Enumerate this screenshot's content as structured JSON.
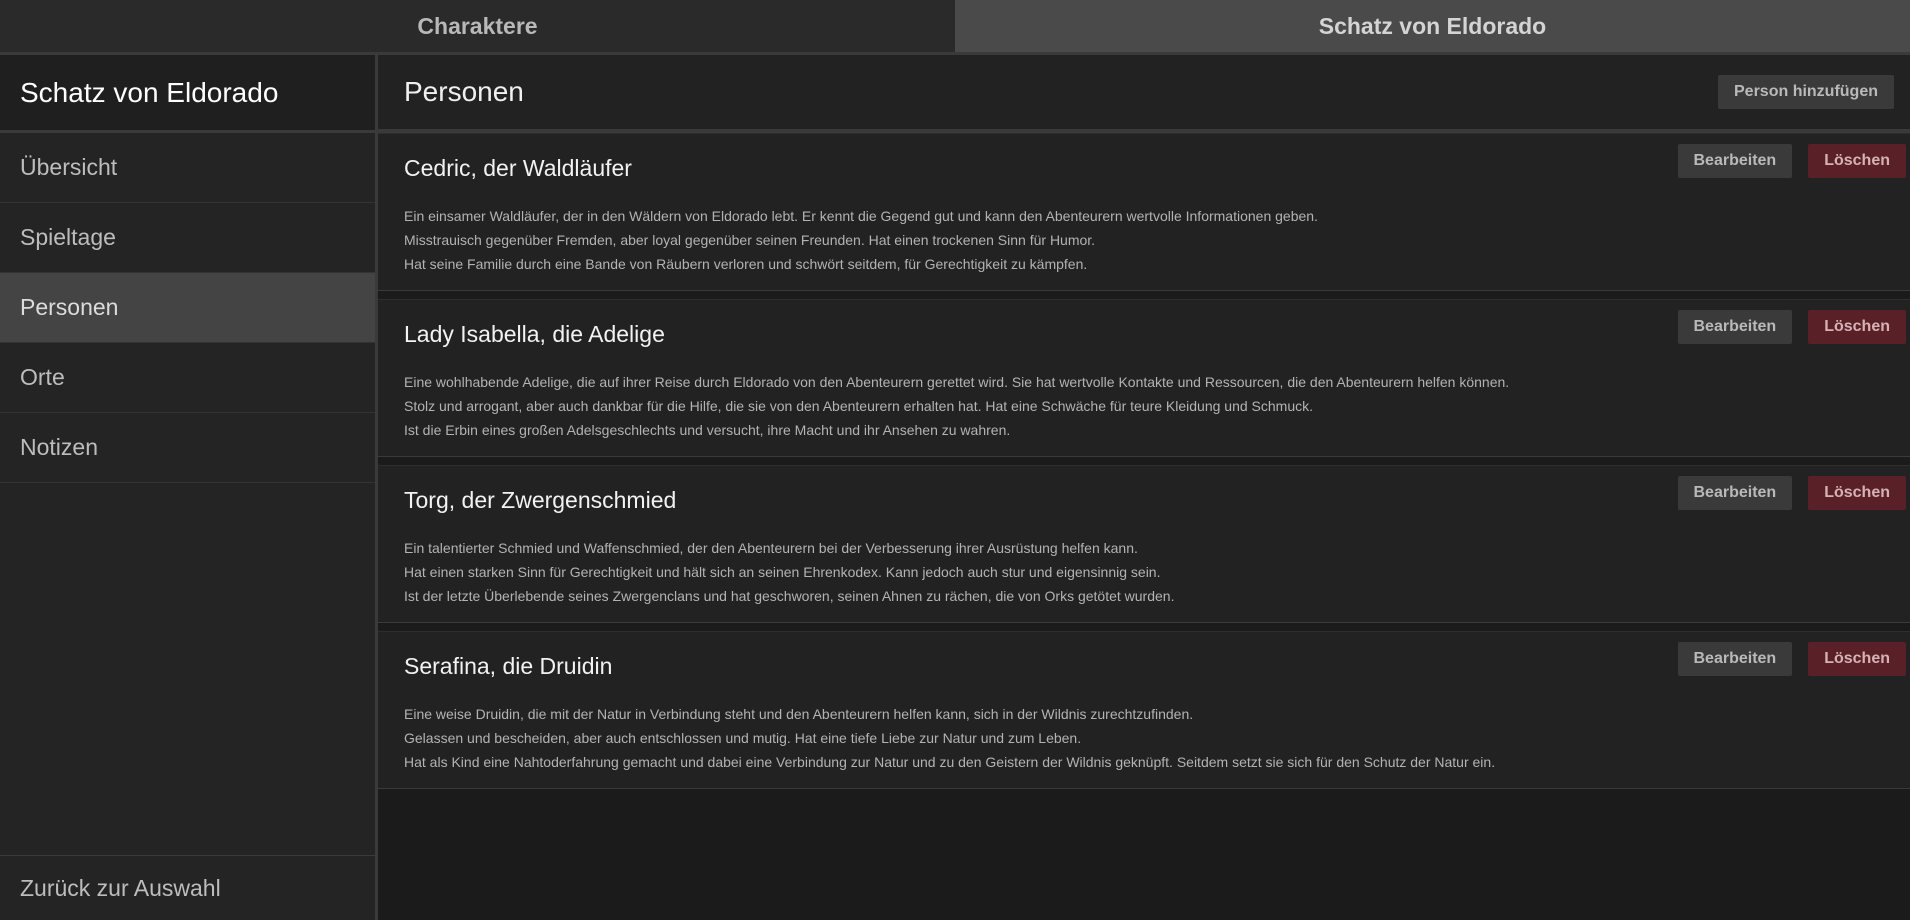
{
  "tabs": [
    {
      "label": "Charaktere",
      "active": false
    },
    {
      "label": "Schatz von Eldorado",
      "active": true
    }
  ],
  "sidebar": {
    "title": "Schatz von Eldorado",
    "items": [
      {
        "label": "Übersicht",
        "active": false
      },
      {
        "label": "Spieltage",
        "active": false
      },
      {
        "label": "Personen",
        "active": true
      },
      {
        "label": "Orte",
        "active": false
      },
      {
        "label": "Notizen",
        "active": false
      }
    ],
    "footer": "Zurück zur Auswahl"
  },
  "main": {
    "title": "Personen",
    "add_label": "Person hinzufügen",
    "edit_label": "Bearbeiten",
    "delete_label": "Löschen",
    "persons": [
      {
        "name": "Cedric, der Waldläufer",
        "lines": [
          "Ein einsamer Waldläufer, der in den Wäldern von Eldorado lebt. Er kennt die Gegend gut und kann den Abenteurern wertvolle Informationen geben.",
          "Misstrauisch gegenüber Fremden, aber loyal gegenüber seinen Freunden. Hat einen trockenen Sinn für Humor.",
          "Hat seine Familie durch eine Bande von Räubern verloren und schwört seitdem, für Gerechtigkeit zu kämpfen."
        ]
      },
      {
        "name": "Lady Isabella, die Adelige",
        "lines": [
          "Eine wohlhabende Adelige, die auf ihrer Reise durch Eldorado von den Abenteurern gerettet wird. Sie hat wertvolle Kontakte und Ressourcen, die den Abenteurern helfen können.",
          "Stolz und arrogant, aber auch dankbar für die Hilfe, die sie von den Abenteurern erhalten hat. Hat eine Schwäche für teure Kleidung und Schmuck.",
          "Ist die Erbin eines großen Adelsgeschlechts und versucht, ihre Macht und ihr Ansehen zu wahren."
        ]
      },
      {
        "name": "Torg, der Zwergenschmied",
        "lines": [
          "Ein talentierter Schmied und Waffenschmied, der den Abenteurern bei der Verbesserung ihrer Ausrüstung helfen kann.",
          "Hat einen starken Sinn für Gerechtigkeit und hält sich an seinen Ehrenkodex. Kann jedoch auch stur und eigensinnig sein.",
          "Ist der letzte Überlebende seines Zwergenclans und hat geschworen, seinen Ahnen zu rächen, die von Orks getötet wurden."
        ]
      },
      {
        "name": "Serafina, die Druidin",
        "lines": [
          "Eine weise Druidin, die mit der Natur in Verbindung steht und den Abenteurern helfen kann, sich in der Wildnis zurechtzufinden.",
          "Gelassen und bescheiden, aber auch entschlossen und mutig. Hat eine tiefe Liebe zur Natur und zum Leben.",
          "Hat als Kind eine Nahtoderfahrung gemacht und dabei eine Verbindung zur Natur und zu den Geistern der Wildnis geknüpft. Seitdem setzt sie sich für den Schutz der Natur ein."
        ]
      }
    ]
  }
}
